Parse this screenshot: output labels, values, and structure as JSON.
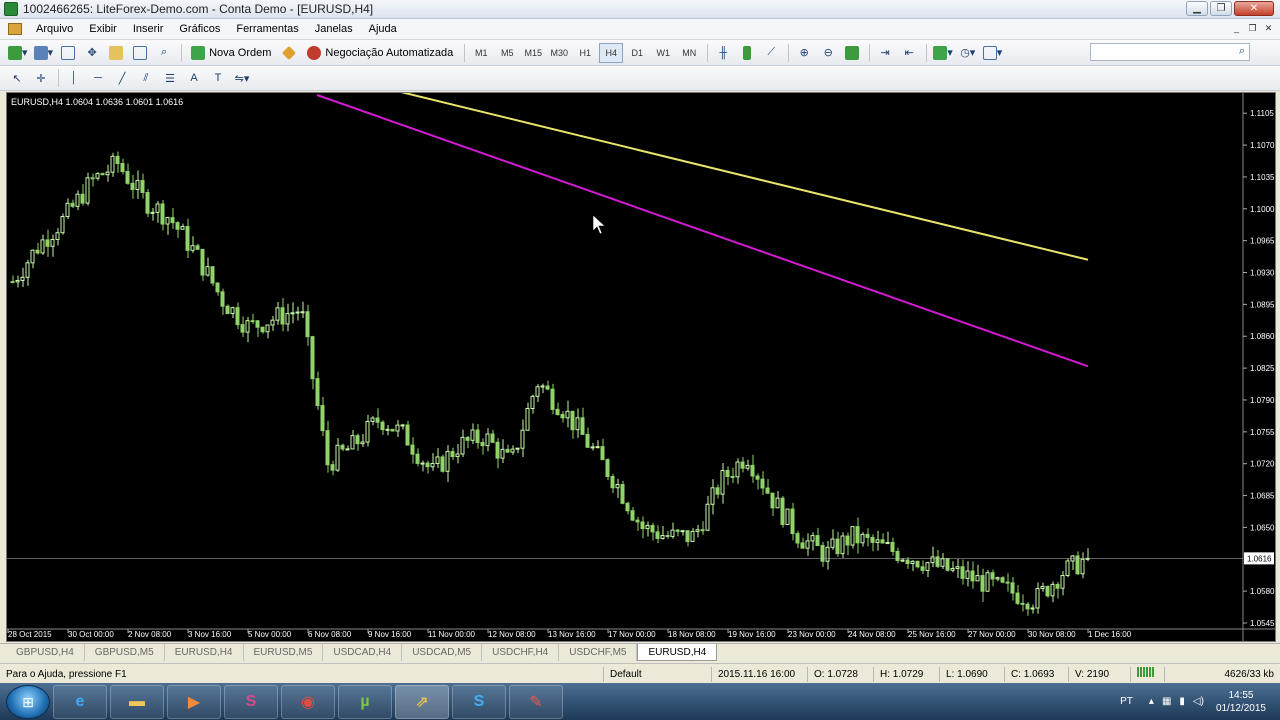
{
  "window": {
    "title": "1002466265: LiteForex-Demo.com - Conta Demo - [EURUSD,H4]"
  },
  "menu": [
    "Arquivo",
    "Exibir",
    "Inserir",
    "Gráficos",
    "Ferramentas",
    "Janelas",
    "Ajuda"
  ],
  "toolbar": {
    "new_order": "Nova Ordem",
    "auto_trading": "Negociação Automatizada",
    "periods": [
      "M1",
      "M5",
      "M15",
      "M30",
      "H1",
      "H4",
      "D1",
      "W1",
      "MN"
    ],
    "active_period": "H4"
  },
  "chart": {
    "info": "EURUSD,H4  1.0604 1.0636 1.0601 1.0616",
    "current_price": "1.0616"
  },
  "chart_data": {
    "type": "candlestick",
    "symbol": "EURUSD",
    "timeframe": "H4",
    "ohlc_current": {
      "open": 1.0604,
      "high": 1.0636,
      "low": 1.0601,
      "close": 1.0616
    },
    "ylim": [
      1.0545,
      1.1125
    ],
    "y_ticks": [
      "1.1105",
      "1.1070",
      "1.1035",
      "1.1000",
      "1.0965",
      "1.0930",
      "1.0895",
      "1.0860",
      "1.0825",
      "1.0790",
      "1.0755",
      "1.0720",
      "1.0685",
      "1.0650",
      "1.0616",
      "1.0580",
      "1.0545"
    ],
    "x_ticks": [
      "28 Oct 2015",
      "30 Oct 00:00",
      "2 Nov 08:00",
      "3 Nov 16:00",
      "5 Nov 00:00",
      "6 Nov 08:00",
      "9 Nov 16:00",
      "11 Nov 00:00",
      "12 Nov 08:00",
      "13 Nov 16:00",
      "17 Nov 00:00",
      "18 Nov 08:00",
      "19 Nov 16:00",
      "23 Nov 00:00",
      "24 Nov 08:00",
      "25 Nov 16:00",
      "27 Nov 00:00",
      "30 Nov 08:00",
      "1 Dec 16:00"
    ],
    "close_path": [
      1.092,
      1.096,
      1.099,
      1.103,
      1.105,
      1.101,
      1.099,
      1.095,
      1.09,
      1.087,
      1.088,
      1.089,
      1.072,
      1.074,
      1.077,
      1.075,
      1.071,
      1.074,
      1.075,
      1.072,
      1.081,
      1.078,
      1.074,
      1.07,
      1.065,
      1.064,
      1.064,
      1.07,
      1.073,
      1.068,
      1.064,
      1.062,
      1.064,
      1.063,
      1.062,
      1.061,
      1.06,
      1.059,
      1.058,
      1.057,
      1.06,
      1.0616
    ],
    "ma_yellow": {
      "start": 1.1128,
      "end": 1.0944,
      "color": "#e8e36a"
    },
    "ma_magenta": {
      "start": 1.1125,
      "end": 1.0827,
      "color": "#d11ad1"
    },
    "up_color": "#c8f7a8",
    "down_color": "#8fd36a"
  },
  "tabs": [
    "GBPUSD,H4",
    "GBPUSD,M5",
    "EURUSD,H4",
    "EURUSD,M5",
    "USDCAD,H4",
    "USDCAD,M5",
    "USDCHF,H4",
    "USDCHF,M5",
    "EURUSD,H4"
  ],
  "active_tab": 8,
  "status": {
    "help": "Para o Ajuda, pressione F1",
    "profile": "Default",
    "time": "2015.11.16 16:00",
    "open": "O: 1.0728",
    "high": "H: 1.0729",
    "low": "L: 1.0690",
    "close": "C: 1.0693",
    "volume": "V: 2190",
    "traffic": "4626/33 kb"
  },
  "tray": {
    "lang": "PT",
    "time": "14:55",
    "date": "01/12/2015"
  }
}
